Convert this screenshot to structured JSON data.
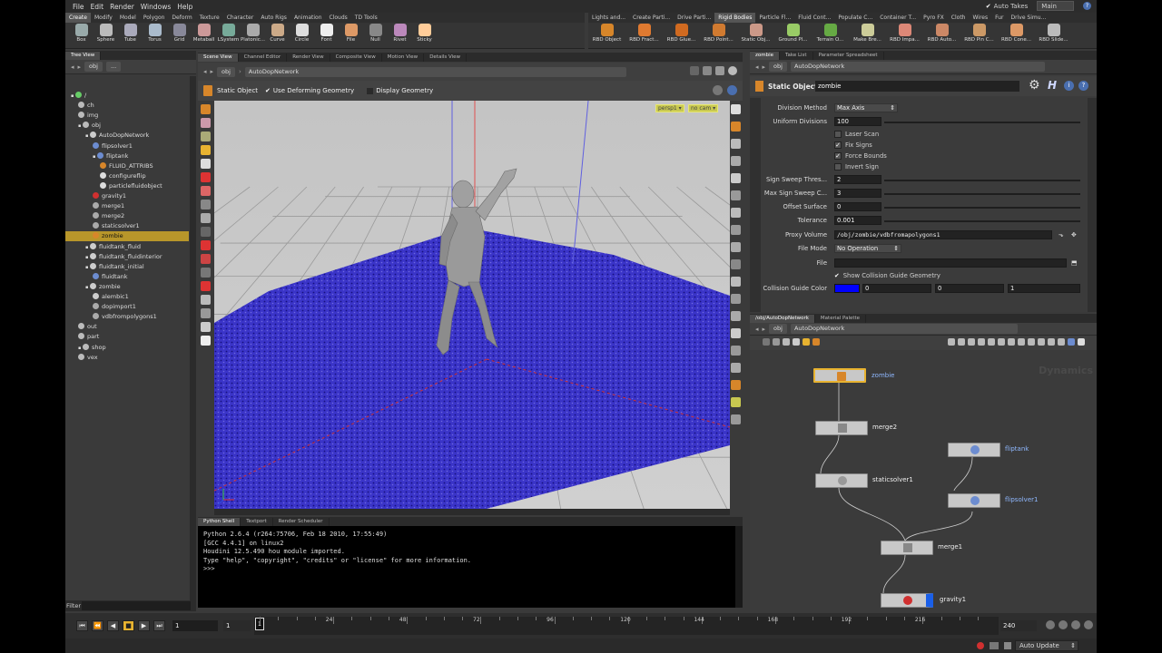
{
  "menu": {
    "items": [
      "File",
      "Edit",
      "Render",
      "Windows",
      "Help"
    ],
    "auto_takes": "Auto Takes",
    "main_select": "Main"
  },
  "shelf": {
    "left_tabs": [
      "Create",
      "Modify",
      "Model",
      "Polygon",
      "Deform",
      "Texture",
      "Character",
      "Auto Rigs",
      "Animation",
      "Clouds",
      "TD Tools"
    ],
    "right_tabs": [
      "Lights and...",
      "Create Parti...",
      "Drive Parti...",
      "Rigid Bodies",
      "Particle Fl...",
      "Fluid Cont...",
      "Populate C...",
      "Container T...",
      "Pyro FX",
      "Cloth",
      "Wires",
      "Fur",
      "Drive Simu..."
    ],
    "left_tools": [
      "Box",
      "Sphere",
      "Tube",
      "Torus",
      "Grid",
      "Metaball",
      "LSystem",
      "Platonic...",
      "Curve",
      "Circle",
      "Font",
      "File",
      "Null",
      "Rivet",
      "Sticky"
    ],
    "right_tools": [
      "RBD Object",
      "RBD Fract...",
      "RBD Glue...",
      "RBD Point...",
      "Static Obj...",
      "Ground Pl...",
      "Terrain O...",
      "Make Bre...",
      "RBD Impa...",
      "RBD Auto...",
      "RBD Pin C...",
      "RBD Cone...",
      "RBD Slide..."
    ]
  },
  "tree": {
    "tab": "Tree View",
    "path": "obj",
    "path2": "...",
    "items": [
      {
        "label": "/",
        "depth": 0
      },
      {
        "label": "ch",
        "depth": 1
      },
      {
        "label": "img",
        "depth": 1
      },
      {
        "label": "obj",
        "depth": 1
      },
      {
        "label": "AutoDopNetwork",
        "depth": 2
      },
      {
        "label": "flipsolver1",
        "depth": 3
      },
      {
        "label": "fliptank",
        "depth": 3
      },
      {
        "label": "FLUID_ATTRIBS",
        "depth": 4
      },
      {
        "label": "configureflip",
        "depth": 4
      },
      {
        "label": "particlefluidobject",
        "depth": 4
      },
      {
        "label": "gravity1",
        "depth": 3
      },
      {
        "label": "merge1",
        "depth": 3
      },
      {
        "label": "merge2",
        "depth": 3
      },
      {
        "label": "staticsolver1",
        "depth": 3
      },
      {
        "label": "zombie",
        "depth": 3
      },
      {
        "label": "fluidtank_fluid",
        "depth": 2
      },
      {
        "label": "fluidtank_fluidinterior",
        "depth": 2
      },
      {
        "label": "fluidtank_initial",
        "depth": 2
      },
      {
        "label": "fluidtank",
        "depth": 3
      },
      {
        "label": "zombie",
        "depth": 2
      },
      {
        "label": "alembic1",
        "depth": 3
      },
      {
        "label": "dopimport1",
        "depth": 3
      },
      {
        "label": "vdbfrompolygons1",
        "depth": 3
      },
      {
        "label": "out",
        "depth": 1
      },
      {
        "label": "part",
        "depth": 1
      },
      {
        "label": "shop",
        "depth": 1
      },
      {
        "label": "vex",
        "depth": 1
      }
    ],
    "filter_label": "Filter"
  },
  "viewport": {
    "tabs": [
      "Scene View",
      "Channel Editor",
      "Render View",
      "Composite View",
      "Motion View",
      "Details View"
    ],
    "path_root": "obj",
    "path_node": "AutoDopNetwork",
    "tool_name": "Static Object",
    "opt_deforming": "Use Deforming Geometry",
    "opt_display": "Display Geometry",
    "cam_persp": "persp1",
    "cam_nocam": "no cam"
  },
  "console": {
    "tabs": [
      "Python Shell",
      "Textport",
      "Render Scheduler"
    ],
    "lines": [
      "Python 2.6.4 (r264:75706, Feb 18 2010, 17:55:49)",
      "[GCC 4.4.1] on linux2",
      "Houdini 12.5.490 hou module imported.",
      "Type \"help\", \"copyright\", \"credits\" or \"license\" for more information.",
      ">>>"
    ]
  },
  "params": {
    "tabs": [
      "zombie",
      "Take List",
      "Parameter Spreadsheet"
    ],
    "path_root": "obj",
    "path_node": "AutoDopNetwork",
    "node_type": "Static Object",
    "node_name": "zombie",
    "division_method_label": "Division Method",
    "division_method_value": "Max Axis",
    "uniform_divisions_label": "Uniform Divisions",
    "uniform_divisions_value": "100",
    "laser_scan": "Laser Scan",
    "fix_signs": "Fix Signs",
    "force_bounds": "Force Bounds",
    "invert_sign": "Invert Sign",
    "sign_sweep_label": "Sign Sweep Thres...",
    "sign_sweep_value": "2",
    "max_sign_sweep_label": "Max Sign Sweep C...",
    "max_sign_sweep_value": "3",
    "offset_surface_label": "Offset Surface",
    "offset_surface_value": "0",
    "tolerance_label": "Tolerance",
    "tolerance_value": "0.001",
    "proxy_volume_label": "Proxy Volume",
    "proxy_volume_value": "/obj/zombie/vdbfromapolygons1",
    "file_mode_label": "File Mode",
    "file_mode_value": "No Operation",
    "file_label": "File",
    "file_value": "",
    "show_guide": "Show Collision Guide Geometry",
    "guide_color_label": "Collision Guide Color",
    "guide_color_r": "0",
    "guide_color_g": "0",
    "guide_color_b": "1"
  },
  "network": {
    "tabs": [
      "/obj/AutoDopNetwork",
      "Material Palette"
    ],
    "path_root": "obj",
    "path_node": "AutoDopNetwork",
    "context_label": "Dynamics",
    "nodes": {
      "zombie": "zombie",
      "merge2": "merge2",
      "staticsolver1": "staticsolver1",
      "fliptank": "fliptank",
      "flipsolver1": "flipsolver1",
      "merge1": "merge1",
      "gravity1": "gravity1"
    }
  },
  "timeline": {
    "current_frame": "1",
    "start_frame": "1",
    "end_frame": "240",
    "tick_labels": [
      "24",
      "48",
      "72",
      "96",
      "120",
      "144",
      "168",
      "192",
      "216"
    ],
    "frame_marker": "1"
  },
  "status": {
    "auto_update": "Auto Update"
  },
  "colors": {
    "accent": "#b8962a",
    "particles": "#2a1fd0",
    "guide_color": "#0000ff"
  }
}
